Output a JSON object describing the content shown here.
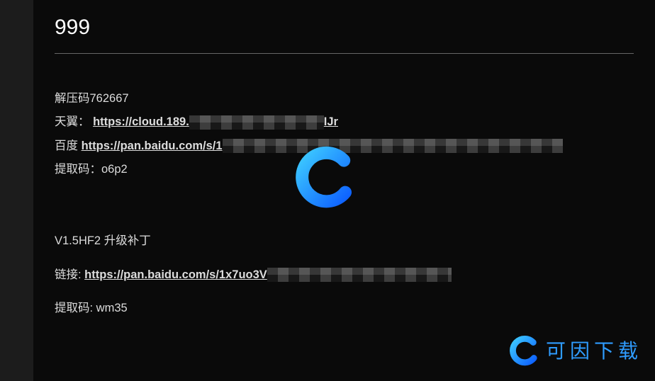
{
  "title": "999",
  "section1": {
    "unzip_line": "解压码762667",
    "tianyi_label": "天翼：",
    "tianyi_link": "https://cloud.189.",
    "tianyi_tail": "IJr",
    "baidu_label": "百度  ",
    "baidu_link": "https://pan.baidu.com/s/1",
    "extract_label": "提取码：",
    "extract_code": "o6p2"
  },
  "section2": {
    "patch_title": "V1.5HF2 升级补丁",
    "link_label": "链接: ",
    "patch_link": "https://pan.baidu.com/s/1x7uo3V",
    "extract_label": "提取码: ",
    "extract_code": "wm35"
  },
  "watermark": {
    "brand_text": "可因下载"
  }
}
